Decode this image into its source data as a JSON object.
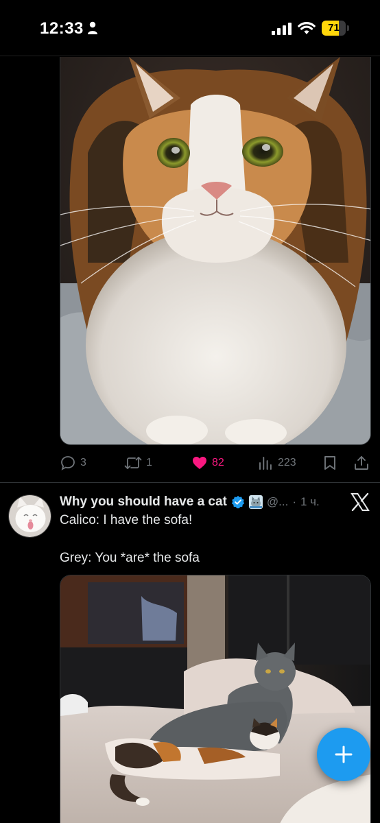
{
  "status_bar": {
    "time": "12:33",
    "battery_level": "71",
    "battery_percent": 71,
    "battery_color": "#ffd60a"
  },
  "previous_post": {
    "image_icon": "calico-cat-photo",
    "replies": "3",
    "reposts": "1",
    "likes": "82",
    "views": "223",
    "like_color": "#f91880"
  },
  "post": {
    "author": "Why you should have a cat",
    "handle": "@...",
    "separator": "·",
    "time": "1 ч.",
    "lines": [
      "Calico: I have the sofa!",
      "Grey: You *are* the sofa"
    ],
    "image_icon": "grey-and-calico-cats-on-sofa-photo",
    "verified_color": "#1d9bf0"
  },
  "compose_button_color": "#1d9bf0"
}
